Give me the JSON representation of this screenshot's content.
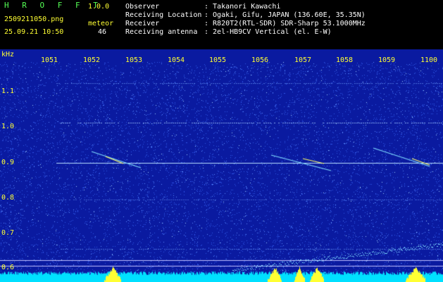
{
  "header": {
    "app_name": "H R O F F T",
    "version": "1.0.0",
    "filename": "2509211050.png",
    "datetime": "25.09.21 10:50",
    "meteor_label": "meteor",
    "meteor_count": "46",
    "info": [
      {
        "label": "Observer",
        "value": ": Takanori Kawachi"
      },
      {
        "label": "Receiving Location",
        "value": ": Ogaki, Gifu, JAPAN (136.60E, 35.35N)"
      },
      {
        "label": "Receiver",
        "value": ": R820T2(RTL-SDR) SDR-Sharp 53.1000MHz"
      },
      {
        "label": "Receiving antenna",
        "value": ": 2el-HB9CV Vertical (el. E-W)"
      }
    ]
  },
  "axes": {
    "y_unit": "kHz",
    "x_ticks": [
      "1051",
      "1052",
      "1053",
      "1054",
      "1055",
      "1056",
      "1057",
      "1058",
      "1059",
      "1100"
    ],
    "y_ticks": [
      "1.1",
      "1.0",
      "0.9",
      "0.8",
      "0.7",
      "0.6"
    ]
  },
  "colors": {
    "background": "#0a1aa0",
    "noise": "#3a6bff",
    "signal": "#ffff33",
    "bottom_band": "#00e0ff"
  }
}
